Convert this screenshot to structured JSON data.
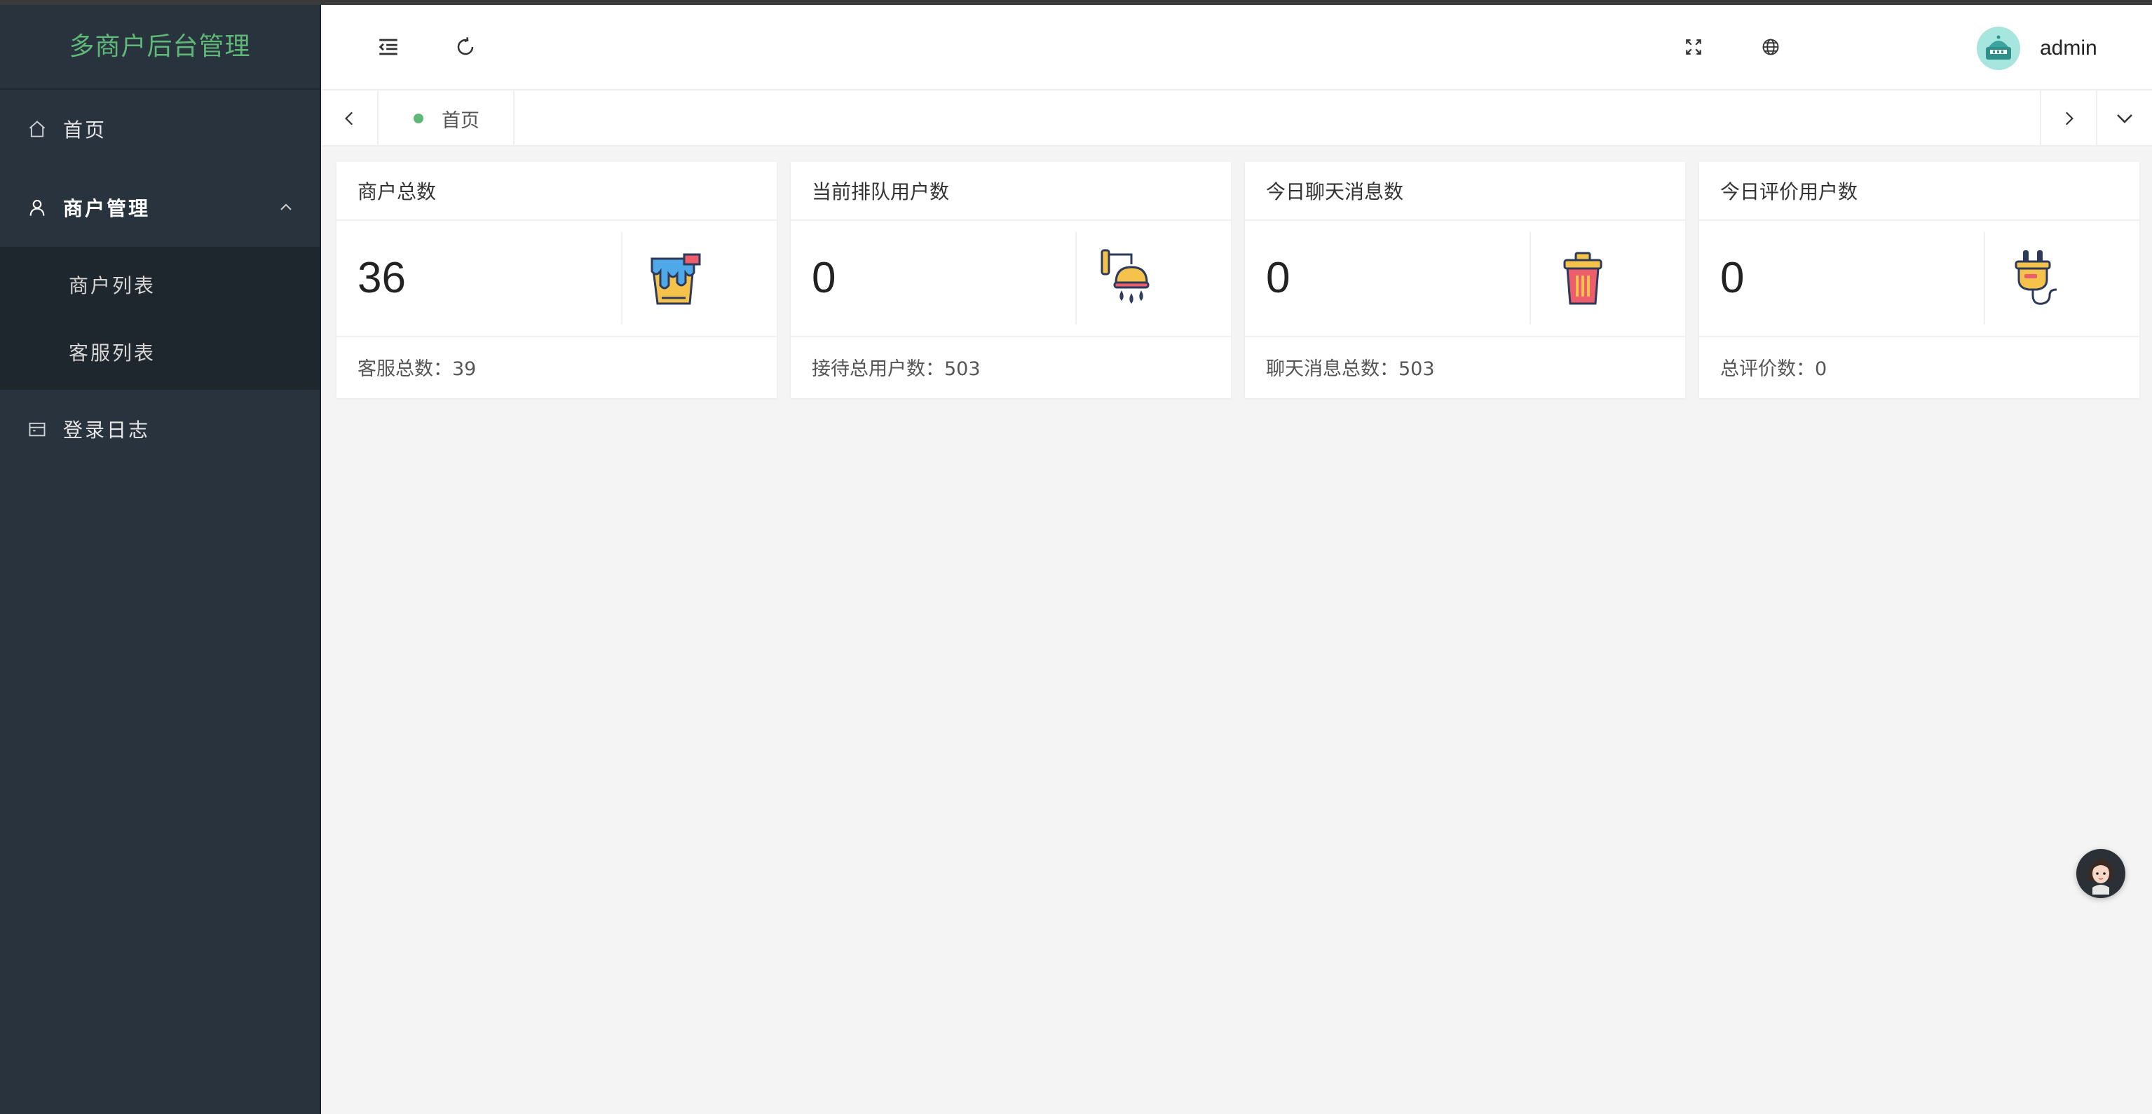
{
  "app": {
    "title": "多商户后台管理"
  },
  "sidebar": {
    "items": [
      {
        "label": "首页",
        "icon": "home-icon"
      },
      {
        "label": "商户管理",
        "icon": "user-icon",
        "expanded": true,
        "children": [
          {
            "label": "商户列表"
          },
          {
            "label": "客服列表"
          }
        ]
      },
      {
        "label": "登录日志",
        "icon": "calendar-icon"
      }
    ]
  },
  "header": {
    "icons": [
      "menu-fold-icon",
      "refresh-icon",
      "fullscreen-icon",
      "globe-icon"
    ],
    "user": {
      "name": "admin"
    }
  },
  "tabs": [
    {
      "label": "首页",
      "active": true
    }
  ],
  "cards": [
    {
      "title": "商户总数",
      "value": "36",
      "footer": "客服总数：39",
      "icon": "paint-bucket-icon"
    },
    {
      "title": "当前排队用户数",
      "value": "0",
      "footer": "接待总用户数：503",
      "icon": "shower-icon"
    },
    {
      "title": "今日聊天消息数",
      "value": "0",
      "footer": "聊天消息总数：503",
      "icon": "trash-can-icon"
    },
    {
      "title": "今日评价用户数",
      "value": "0",
      "footer": "总评价数：0",
      "icon": "plug-icon"
    }
  ],
  "colors": {
    "accent": "#5fb878",
    "sidebar_bg": "#28333e",
    "submenu_bg": "#1e262e",
    "page_bg": "#f4f4f4"
  }
}
